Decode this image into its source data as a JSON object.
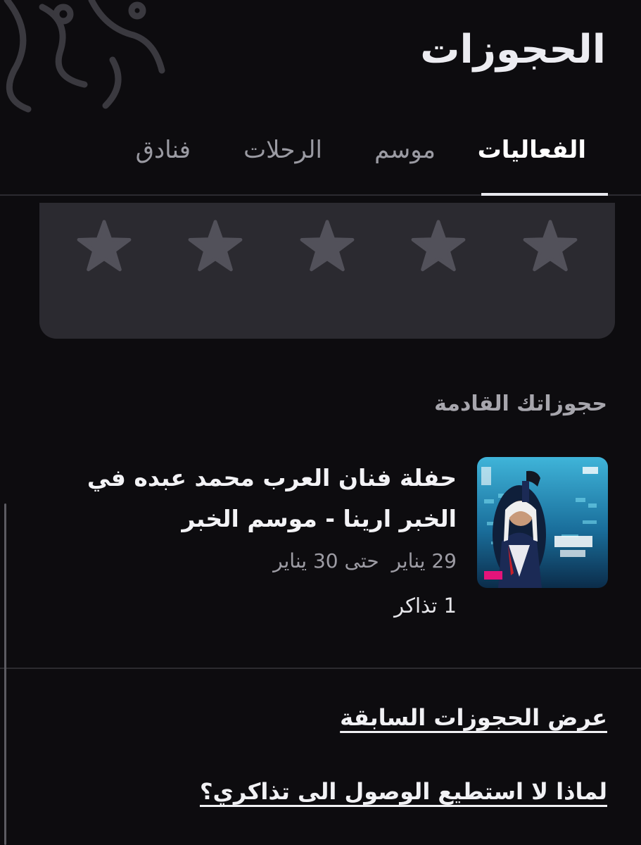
{
  "header": {
    "title": "الحجوزات"
  },
  "tabs": [
    {
      "label": "الفعاليات",
      "active": true
    },
    {
      "label": "موسم",
      "active": false
    },
    {
      "label": "الرحلات",
      "active": false
    },
    {
      "label": "فنادق",
      "active": false
    }
  ],
  "rating": {
    "max": 5,
    "value": 0,
    "star_color": "#52515a"
  },
  "upcoming": {
    "section_title": "حجوزاتك القادمة",
    "booking": {
      "title": "حفلة فنان العرب محمد عبده في الخبر ارينا - موسم الخبر",
      "date_from": "29 يناير",
      "date_to": "حتى 30 يناير",
      "tickets": "1 تذاكر",
      "poster": {
        "icon": "event-poster"
      }
    }
  },
  "links": {
    "past_bookings": "عرض الحجوزات السابقة",
    "ticket_access_help": "لماذا لا استطيع الوصول الى تذاكري؟"
  },
  "colors": {
    "background": "#0d0c0f",
    "card": "#2b2a30",
    "muted_text": "#9d9ca4",
    "divider": "#2c2b30"
  }
}
